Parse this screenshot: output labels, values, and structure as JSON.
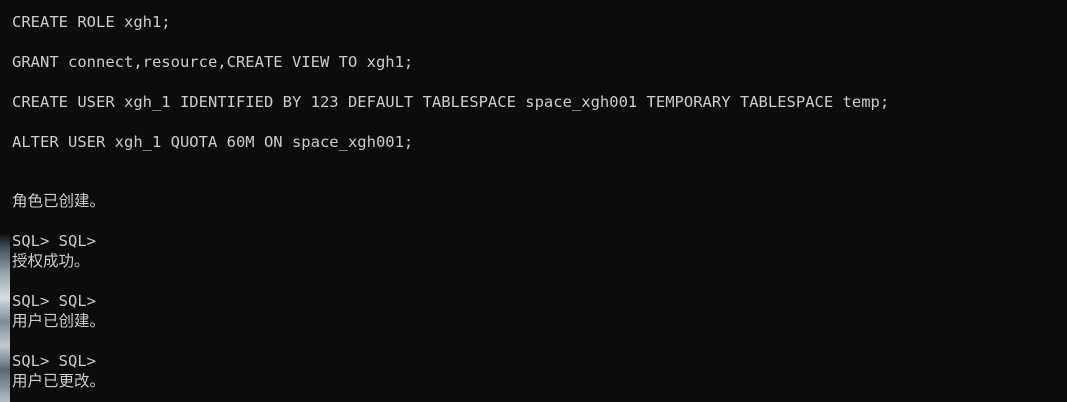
{
  "terminal": {
    "lines": [
      "CREATE ROLE xgh1;",
      "GRANT connect,resource,CREATE VIEW TO xgh1;",
      "CREATE USER xgh_1 IDENTIFIED BY 123 DEFAULT TABLESPACE space_xgh001 TEMPORARY TABLESPACE temp;",
      "ALTER USER xgh_1 QUOTA 60M ON space_xgh001;",
      "角色已创建。",
      "SQL> SQL>",
      "授权成功。",
      "SQL> SQL>",
      "用户已创建。",
      "SQL> SQL>",
      "用户已更改。"
    ]
  }
}
